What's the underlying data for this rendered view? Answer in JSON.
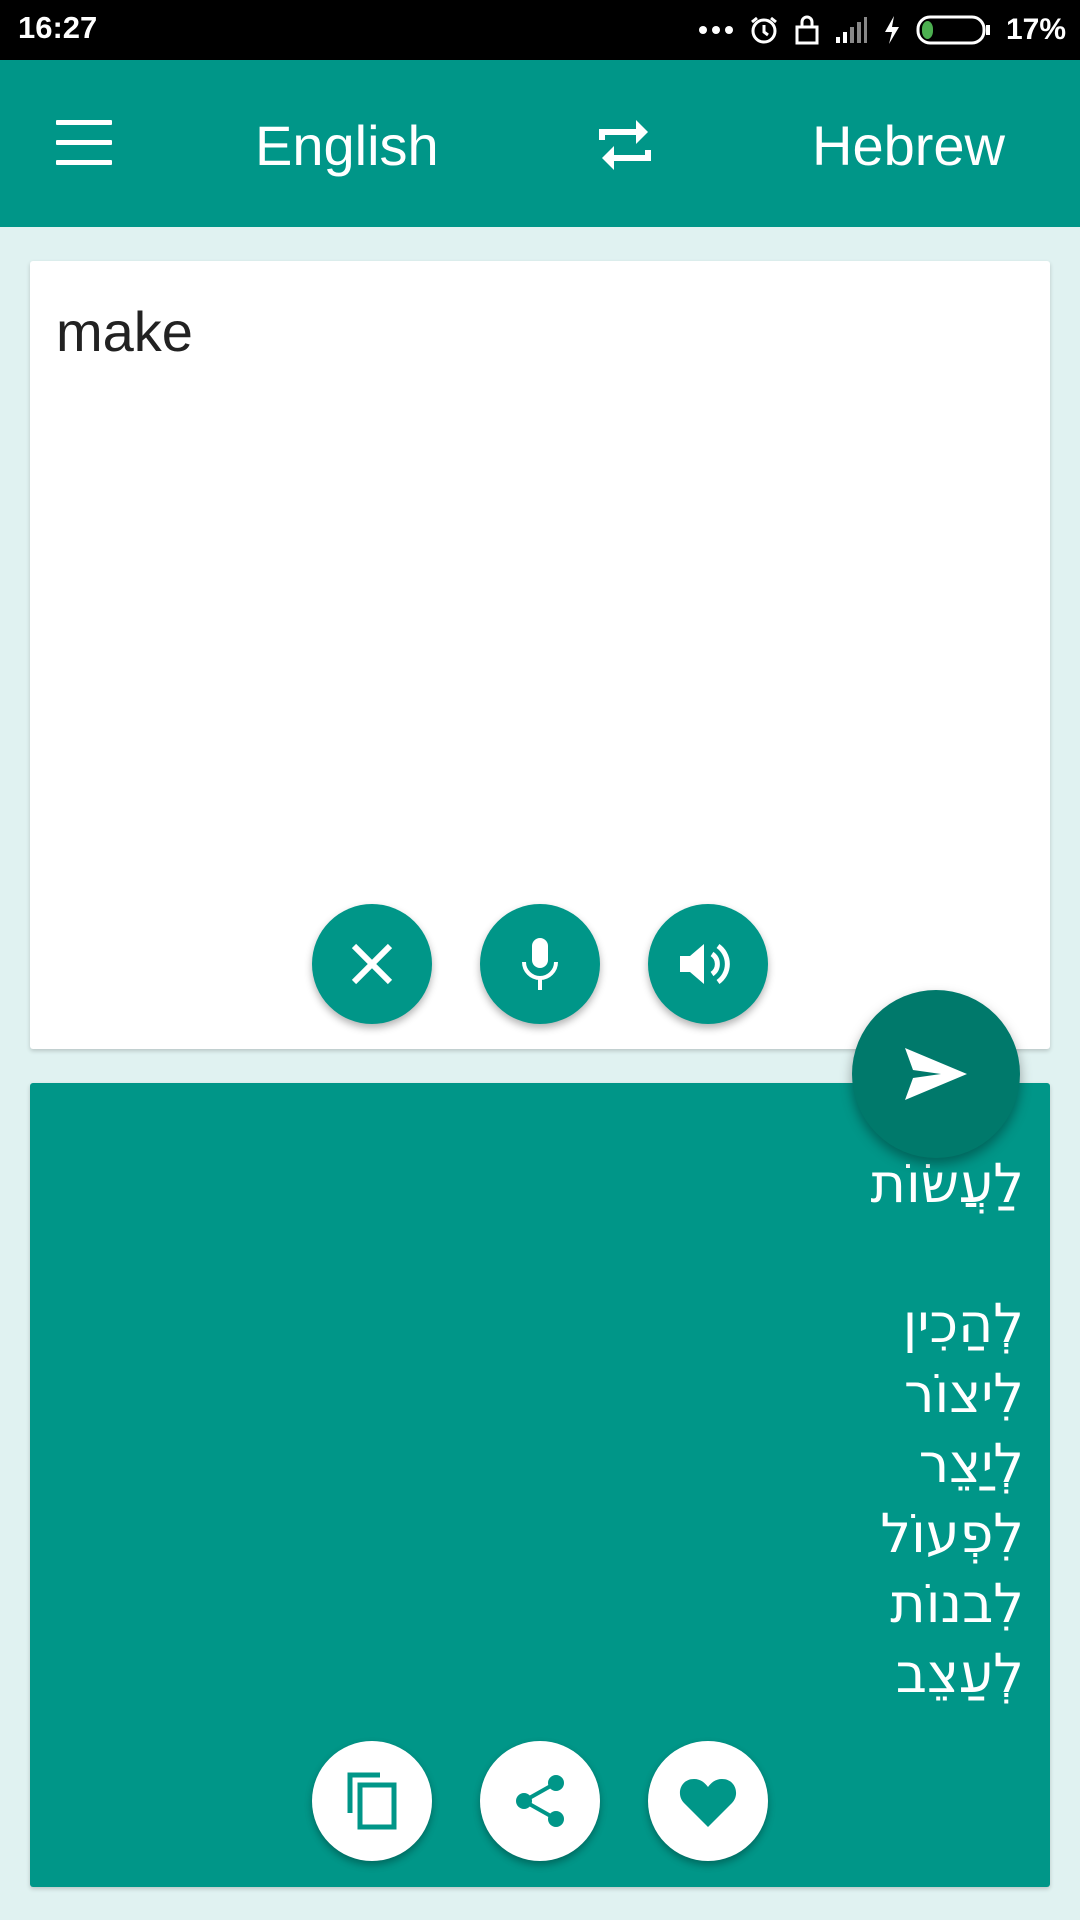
{
  "status_bar": {
    "time": "16:27",
    "battery_percent": "17%",
    "battery_level": 0.17,
    "icons": [
      "more-dots-icon",
      "alarm-icon",
      "lock-icon",
      "signal-icon",
      "charging-icon",
      "battery-icon"
    ]
  },
  "app_bar": {
    "source_language": "English",
    "target_language": "Hebrew",
    "menu_icon": "hamburger-menu-icon",
    "swap_icon": "swap-languages-icon"
  },
  "input": {
    "text": "make",
    "buttons": [
      "clear-icon",
      "microphone-icon",
      "speaker-icon"
    ]
  },
  "translate_fab_icon": "send-icon",
  "output": {
    "main_translation": "לַעֲשׂוֹת",
    "alternatives": [
      "לְהַכִין",
      "לִיצוֹר",
      "לְיַצֵר",
      "לִפְעוֹל",
      "לִבנוֹת",
      "לְעַצֵב"
    ],
    "buttons": [
      "copy-icon",
      "share-icon",
      "favorite-icon"
    ]
  },
  "colors": {
    "primary": "#009688",
    "primary_dark": "#00796b",
    "background": "#e0f2f1"
  }
}
